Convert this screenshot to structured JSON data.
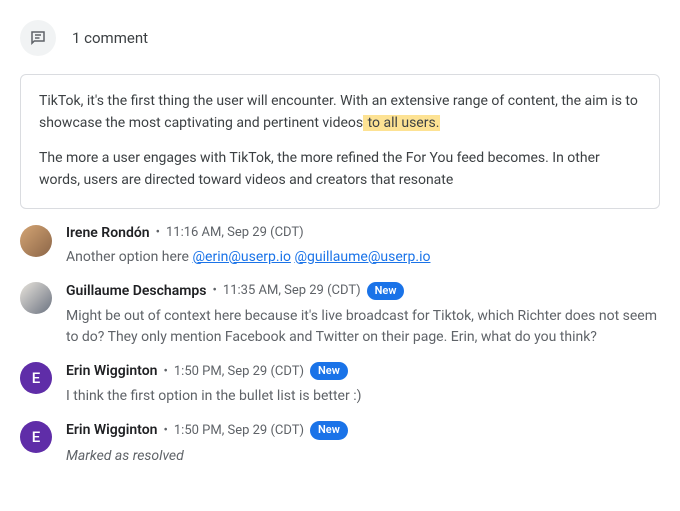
{
  "header": {
    "title": "1 comment"
  },
  "quote": {
    "p1_before": "TikTok, it's the first thing the user will encounter. With an extensive range of content, the aim is to showcase the most captivating and pertinent videos",
    "p1_highlight": " to all users.",
    "p2": "The more a user engages with TikTok, the more refined the For You feed becomes. In other words, users are directed toward videos and creators that resonate"
  },
  "badge_label": "New",
  "comments": [
    {
      "author": "Irene Rondón",
      "timestamp": "11:16 AM, Sep 29 (CDT)",
      "text_before": "Another option here ",
      "mention1": "@erin@userp.io",
      "mention2": "@guillaume@userp.io"
    },
    {
      "author": "Guillaume Deschamps",
      "timestamp": "11:35 AM, Sep 29 (CDT)",
      "text": "Might be out of context here because it's live broadcast for Tiktok, which Richter does not seem to do? They only mention Facebook and Twitter on their page. Erin, what do you think?"
    },
    {
      "author": "Erin Wigginton",
      "avatar_letter": "E",
      "timestamp": "1:50 PM, Sep 29 (CDT)",
      "text": "I think the first option in the bullet list is better :)"
    },
    {
      "author": "Erin Wigginton",
      "avatar_letter": "E",
      "timestamp": "1:50 PM, Sep 29 (CDT)",
      "resolved": "Marked as resolved"
    }
  ]
}
